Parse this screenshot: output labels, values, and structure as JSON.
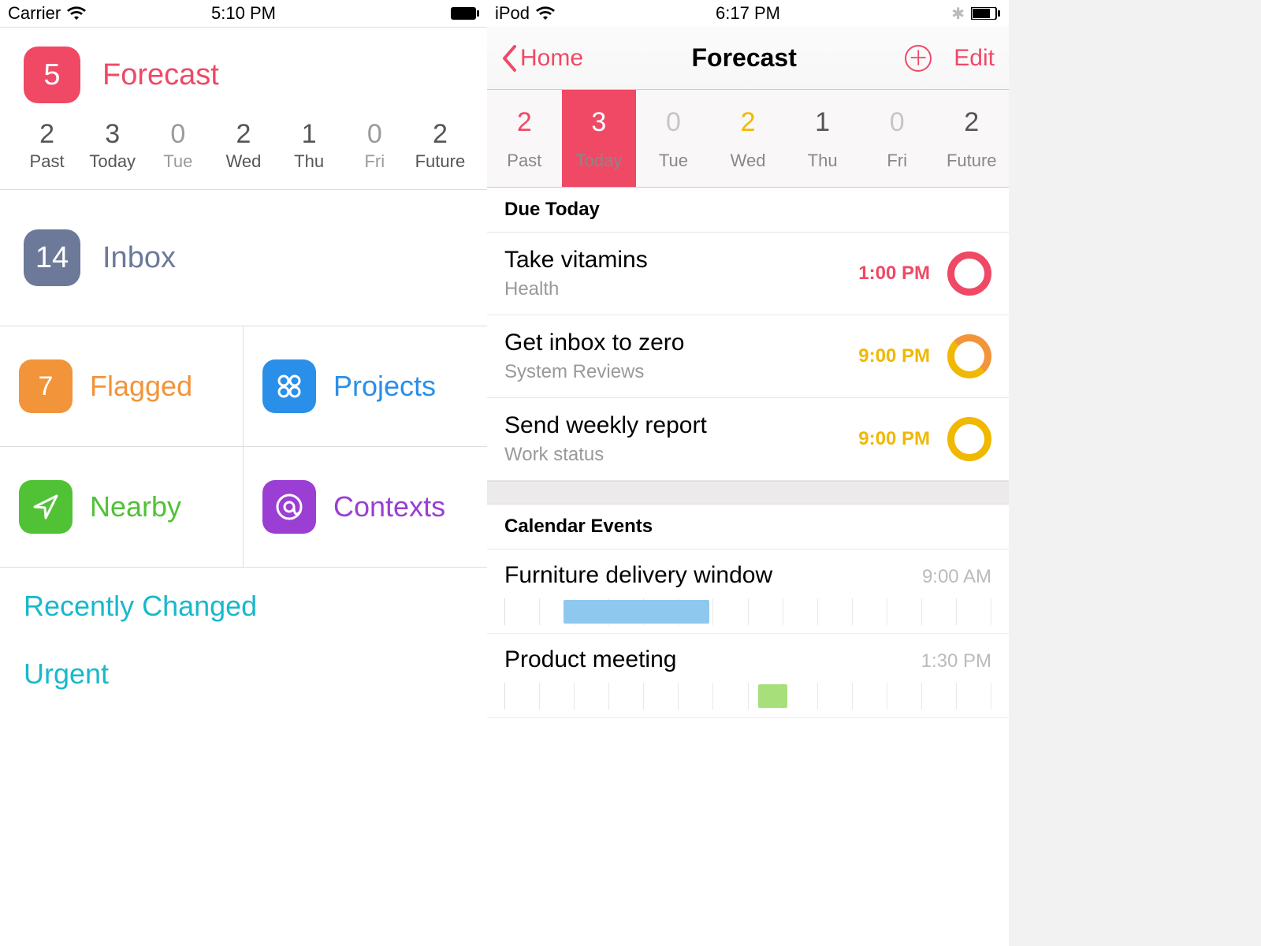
{
  "colors": {
    "pink": "#ef4966",
    "slate": "#6c7999",
    "orange": "#f2943a",
    "blue": "#2a8fe8",
    "green": "#51c236",
    "purple": "#9b3ed4",
    "teal": "#17b9cb",
    "yellow": "#f0b800"
  },
  "left": {
    "status": {
      "carrier": "Carrier",
      "time": "5:10 PM"
    },
    "forecast": {
      "count": "5",
      "label": "Forecast"
    },
    "days": [
      {
        "num": "2",
        "lbl": "Past",
        "active": true
      },
      {
        "num": "3",
        "lbl": "Today",
        "active": true
      },
      {
        "num": "0",
        "lbl": "Tue",
        "active": false
      },
      {
        "num": "2",
        "lbl": "Wed",
        "active": true
      },
      {
        "num": "1",
        "lbl": "Thu",
        "active": true
      },
      {
        "num": "0",
        "lbl": "Fri",
        "active": false
      },
      {
        "num": "2",
        "lbl": "Future",
        "active": true
      }
    ],
    "inbox": {
      "count": "14",
      "label": "Inbox"
    },
    "flagged": {
      "count": "7",
      "label": "Flagged"
    },
    "projects": {
      "label": "Projects"
    },
    "nearby": {
      "label": "Nearby"
    },
    "contexts": {
      "label": "Contexts"
    },
    "recent": "Recently Changed",
    "urgent": "Urgent"
  },
  "right": {
    "status": {
      "carrier": "iPod",
      "time": "6:17 PM"
    },
    "nav": {
      "back": "Home",
      "title": "Forecast",
      "edit": "Edit"
    },
    "days": [
      {
        "num": "2",
        "lbl": "Past",
        "cls": "red"
      },
      {
        "num": "3",
        "lbl": "Today",
        "sel": true
      },
      {
        "num": "0",
        "lbl": "Tue",
        "cls": "gray"
      },
      {
        "num": "2",
        "lbl": "Wed",
        "cls": "yellow"
      },
      {
        "num": "1",
        "lbl": "Thu",
        "cls": "black"
      },
      {
        "num": "0",
        "lbl": "Fri",
        "cls": "gray"
      },
      {
        "num": "2",
        "lbl": "Future",
        "cls": "black"
      }
    ],
    "section_due": "Due Today",
    "tasks": [
      {
        "title": "Take vitamins",
        "sub": "Health",
        "time": "1:00 PM",
        "time_color": "#ef4966",
        "ring_color": "#ef4966"
      },
      {
        "title": "Get inbox to zero",
        "sub": "System Reviews",
        "time": "9:00 PM",
        "time_color": "#f0b800",
        "ring_color": "#f0b800",
        "ring_top": "#f2943a"
      },
      {
        "title": "Send weekly report",
        "sub": "Work status",
        "time": "9:00 PM",
        "time_color": "#f0b800",
        "ring_color": "#f0b800"
      }
    ],
    "section_events": "Calendar Events",
    "events": [
      {
        "title": "Furniture delivery window",
        "time": "9:00 AM",
        "start_pct": 12,
        "width_pct": 30,
        "color": "blue"
      },
      {
        "title": "Product meeting",
        "time": "1:30 PM",
        "start_pct": 52,
        "width_pct": 6,
        "color": "green"
      }
    ]
  }
}
